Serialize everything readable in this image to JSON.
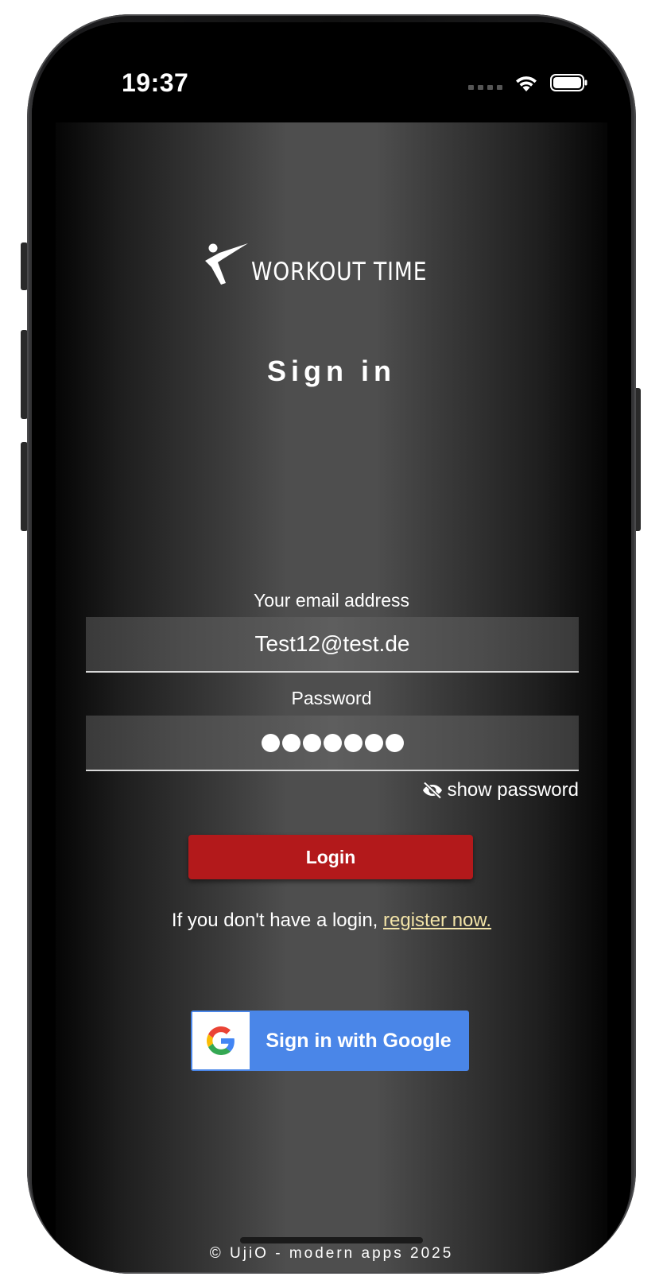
{
  "status_bar": {
    "time": "19:37",
    "icons": [
      "signal-icon",
      "wifi-icon",
      "battery-icon"
    ]
  },
  "app": {
    "logo_text": "WORKOUT TIME",
    "title": "Sign in",
    "email": {
      "label": "Your email address",
      "value": "Test12@test.de"
    },
    "password": {
      "label": "Password",
      "masked_length": 7
    },
    "show_password_label": "show password",
    "login_label": "Login",
    "register_prefix": "If you don't have a login, ",
    "register_link": "register now.",
    "google_label": "Sign in with Google",
    "footer": "© UjiO - modern apps 2025"
  },
  "colors": {
    "login_button": "#b3191b",
    "google_button": "#4a86e8",
    "register_link": "#f3e4a8"
  }
}
